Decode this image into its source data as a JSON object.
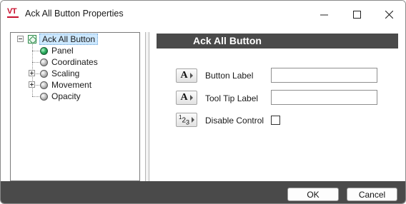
{
  "window": {
    "title": "Ack All Button Properties",
    "logo_text": "VT",
    "brand_color": "#c8102e",
    "icons": {
      "minimize": "minimize-icon",
      "maximize": "maximize-icon",
      "close": "close-icon"
    }
  },
  "tree": {
    "root": {
      "label": "Ack All Button",
      "expanded": true,
      "selected": true,
      "icon": "container-icon"
    },
    "items": [
      {
        "label": "Panel",
        "icon": "green-ball-icon",
        "expandable": false
      },
      {
        "label": "Coordinates",
        "icon": "gray-ball-icon",
        "expandable": false
      },
      {
        "label": "Scaling",
        "icon": "gray-ball-icon",
        "expandable": true
      },
      {
        "label": "Movement",
        "icon": "gray-ball-icon",
        "expandable": true
      },
      {
        "label": "Opacity",
        "icon": "gray-ball-icon",
        "expandable": false
      }
    ]
  },
  "panel": {
    "header": "Ack All Button",
    "header_color": "#4a4a4a",
    "properties": [
      {
        "label": "Button Label",
        "icon_text": "A",
        "value": ""
      },
      {
        "label": "Tool Tip Label",
        "icon_text": "A",
        "value": ""
      },
      {
        "label": "Disable Control",
        "icon_text": "123",
        "checked": false
      }
    ]
  },
  "footer": {
    "ok_label": "OK",
    "cancel_label": "Cancel"
  }
}
